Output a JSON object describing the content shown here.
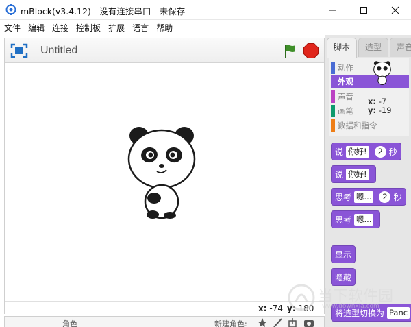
{
  "window": {
    "title": "mBlock(v3.4.12) - 没有连接串口 - 未保存"
  },
  "menu": [
    "文件",
    "编辑",
    "连接",
    "控制板",
    "扩展",
    "语言",
    "帮助"
  ],
  "stage": {
    "title": "Untitled",
    "mouse_x_label": "x:",
    "mouse_x": "-74",
    "mouse_y_label": "y:",
    "mouse_y": "180"
  },
  "sprite_bar": {
    "sprite_label": "角色",
    "new_sprite_label": "新建角色:"
  },
  "tabs": [
    "脚本",
    "造型",
    "声音"
  ],
  "categories": [
    {
      "label": "动作",
      "color": "#4a6cd4"
    },
    {
      "label": "外观",
      "color": "#8a55d7",
      "active": true
    },
    {
      "label": "声音",
      "color": "#bb42c3"
    },
    {
      "label": "画笔",
      "color": "#0e9a6c"
    },
    {
      "label": "数据和指令",
      "color": "#ee7d16"
    }
  ],
  "sprite_info": {
    "x_label": "x:",
    "x": "-7",
    "y_label": "y:",
    "y": "-19"
  },
  "blocks": [
    {
      "parts": [
        "说",
        "你好!",
        "2",
        "秒"
      ]
    },
    {
      "parts": [
        "说",
        "你好!"
      ]
    },
    {
      "parts": [
        "思考",
        "嗯...",
        "2",
        "秒"
      ]
    },
    {
      "parts": [
        "思考",
        "嗯..."
      ]
    },
    {
      "parts": [
        "显示"
      ]
    },
    {
      "parts": [
        "隐藏"
      ]
    },
    {
      "parts": [
        "将造型切换为",
        "Panc"
      ]
    }
  ],
  "watermark": {
    "text": "当下软件园",
    "sub": "www.downxia.com"
  },
  "colors": {
    "looks": "#8a55d7",
    "flag": "#3f8f2a",
    "stop": "#e0261c"
  }
}
